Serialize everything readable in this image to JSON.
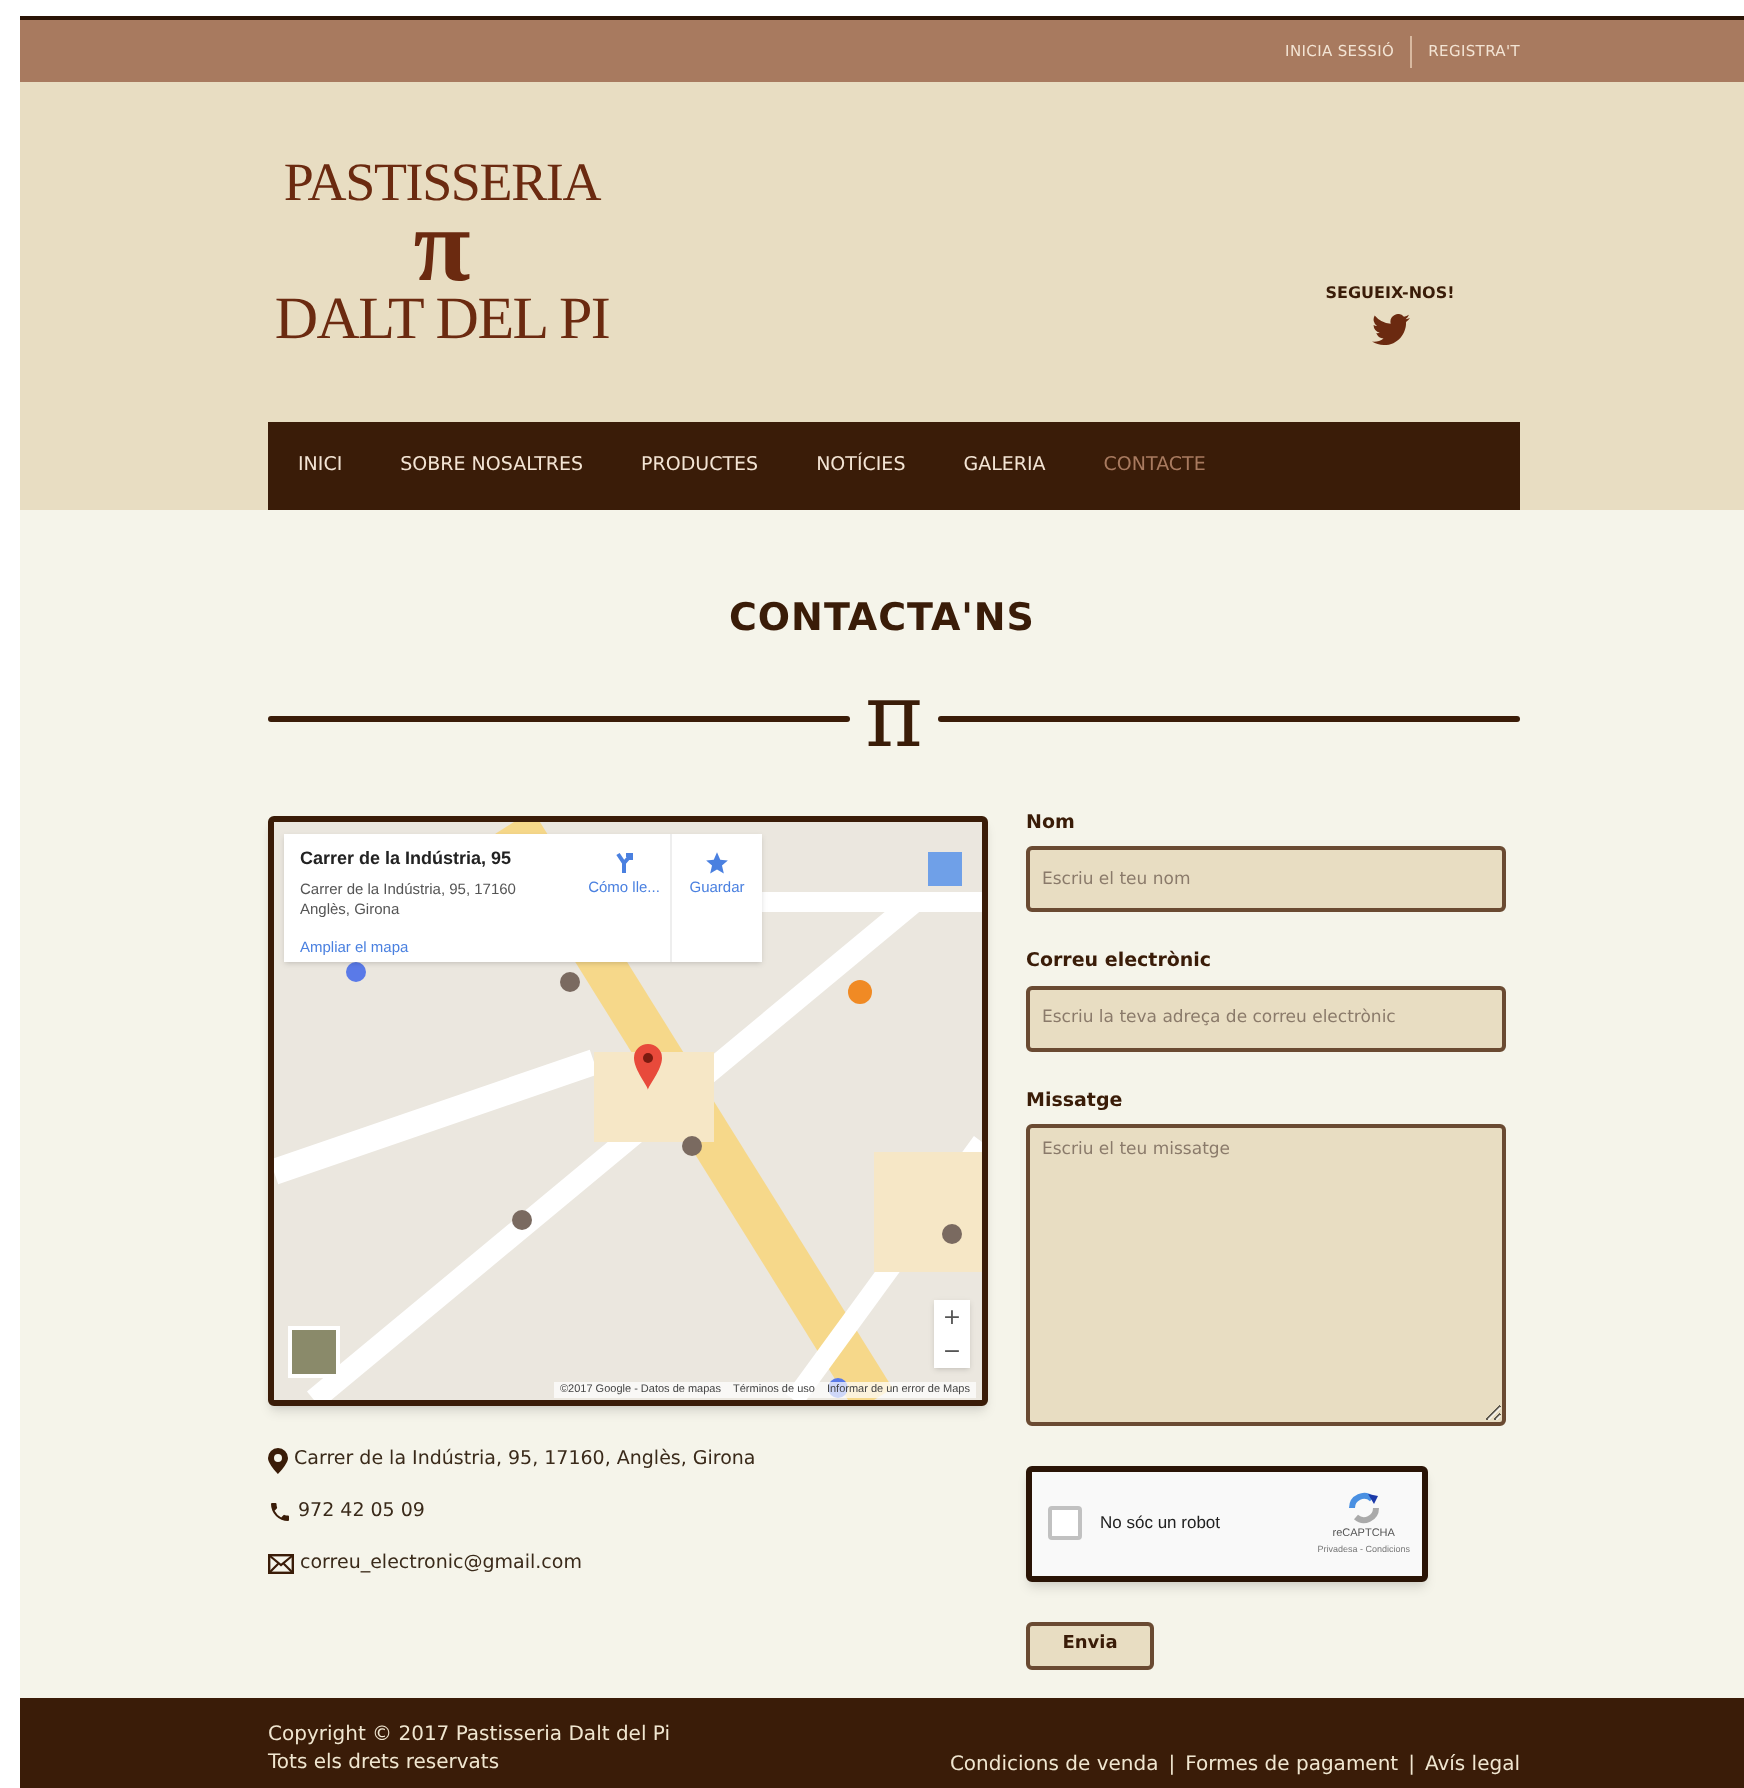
{
  "top_bar": {
    "links": [
      "INICIA SESSIÓ",
      "REGISTRA'T"
    ]
  },
  "logo": {
    "line_1": "PASTISSERIA",
    "symbol": "π",
    "line_2": "DALT DEL PI"
  },
  "social": {
    "label": "SEGUEIX-NOS!"
  },
  "nav": [
    {
      "label": "INICI",
      "selected": false
    },
    {
      "label": "SOBRE NOSALTRES",
      "selected": false
    },
    {
      "label": "PRODUCTES",
      "selected": false
    },
    {
      "label": "NOTÍCIES",
      "selected": false
    },
    {
      "label": "GALERIA",
      "selected": false
    },
    {
      "label": "CONTACTE",
      "selected": true
    }
  ],
  "heading": "CONTACTA'NS",
  "divider_symbol": "π",
  "map": {
    "card_title": "Carrer de la Indústria, 95",
    "card_address": "Carrer de la Indústria, 95, 17160 Anglès, Girona",
    "card_link": "Ampliar el mapa",
    "directions": "Cómo lle...",
    "save": "Guardar",
    "zoom_in": "+",
    "zoom_out": "−",
    "attribution": [
      "©2017 Google - Datos de mapas",
      "Términos de uso",
      "Informar de un error de Maps"
    ]
  },
  "contact": [
    {
      "kind": "address",
      "text": "Carrer de la Indústria, 95, 17160, Anglès, Girona"
    },
    {
      "kind": "phone",
      "text": "972 42 05 09"
    },
    {
      "kind": "email",
      "text": "correu_electronic@gmail.com"
    }
  ],
  "form": {
    "fields": [
      {
        "kind": "input",
        "label": "Nom",
        "placeholder": "Escriu el teu nom"
      },
      {
        "kind": "input",
        "label": "Correu electrònic",
        "placeholder": "Escriu la teva adreça de correu electrònic"
      },
      {
        "kind": "textarea",
        "label": "Missatge",
        "placeholder": "Escriu el teu missatge"
      }
    ],
    "captcha": {
      "label": "No sóc un robot",
      "checked": false,
      "brand": "reCAPTCHA",
      "terms": "Privadesa - Condicions"
    },
    "submit": "Envia"
  },
  "footer": {
    "copyright": "Copyright © 2017 Pastisseria Dalt del Pi",
    "rights": "Tots els drets reservats",
    "links": [
      "Condicions de venda",
      "Formes de pagament",
      "Avís legal"
    ],
    "separator": "|"
  }
}
